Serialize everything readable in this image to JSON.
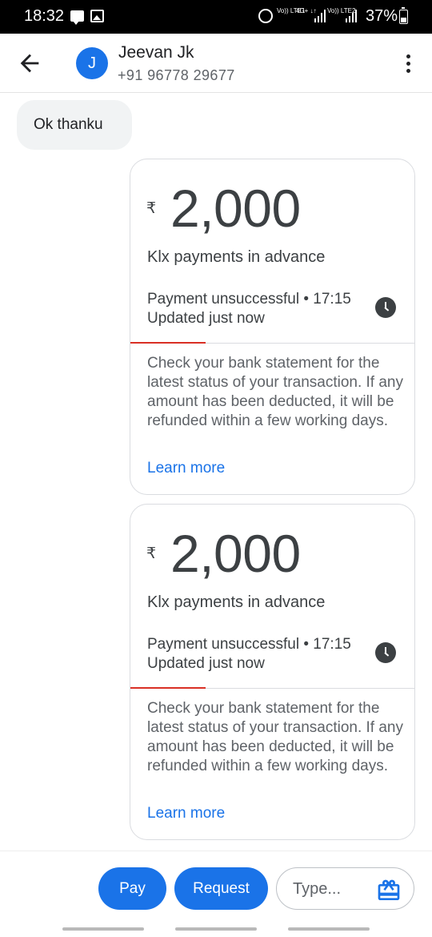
{
  "status_bar": {
    "time": "18:32",
    "network": [
      "Vo)) LTE1",
      "4G+ ↓↑",
      "Vo)) LTE2"
    ],
    "battery": "37%"
  },
  "header": {
    "back_icon": "arrow-left-icon",
    "avatar_letter": "J",
    "avatar_color": "#1a73e8",
    "contact_name": "Jeevan Jk",
    "contact_phone": "+91 96778 29677",
    "menu_icon": "more-vert-icon"
  },
  "messages": [
    {
      "type": "text",
      "text": "Ok thanku"
    }
  ],
  "payments": [
    {
      "currency": "₹",
      "amount": "2,000",
      "note": "Klx payments in advance",
      "status_line": "Payment unsuccessful • 17:15",
      "updated": "Updated just now",
      "status_icon": "clock-icon",
      "status_color": "#d93025",
      "info": "Check your bank statement for the latest status of your transaction. If any amount has been deducted, it will be refunded within a few working days.",
      "link": "Learn more"
    },
    {
      "currency": "₹",
      "amount": "2,000",
      "note": "Klx payments in advance",
      "status_line": "Payment unsuccessful • 17:15",
      "updated": "Updated just now",
      "status_icon": "clock-icon",
      "status_color": "#d93025",
      "info": "Check your bank statement for the latest status of your transaction. If any amount has been deducted, it will be refunded within a few working days.",
      "link": "Learn more"
    }
  ],
  "compose": {
    "pay_label": "Pay",
    "request_label": "Request",
    "input_placeholder": "Type...",
    "input_value": "",
    "gift_icon": "gift-icon",
    "accent": "#1a73e8"
  }
}
